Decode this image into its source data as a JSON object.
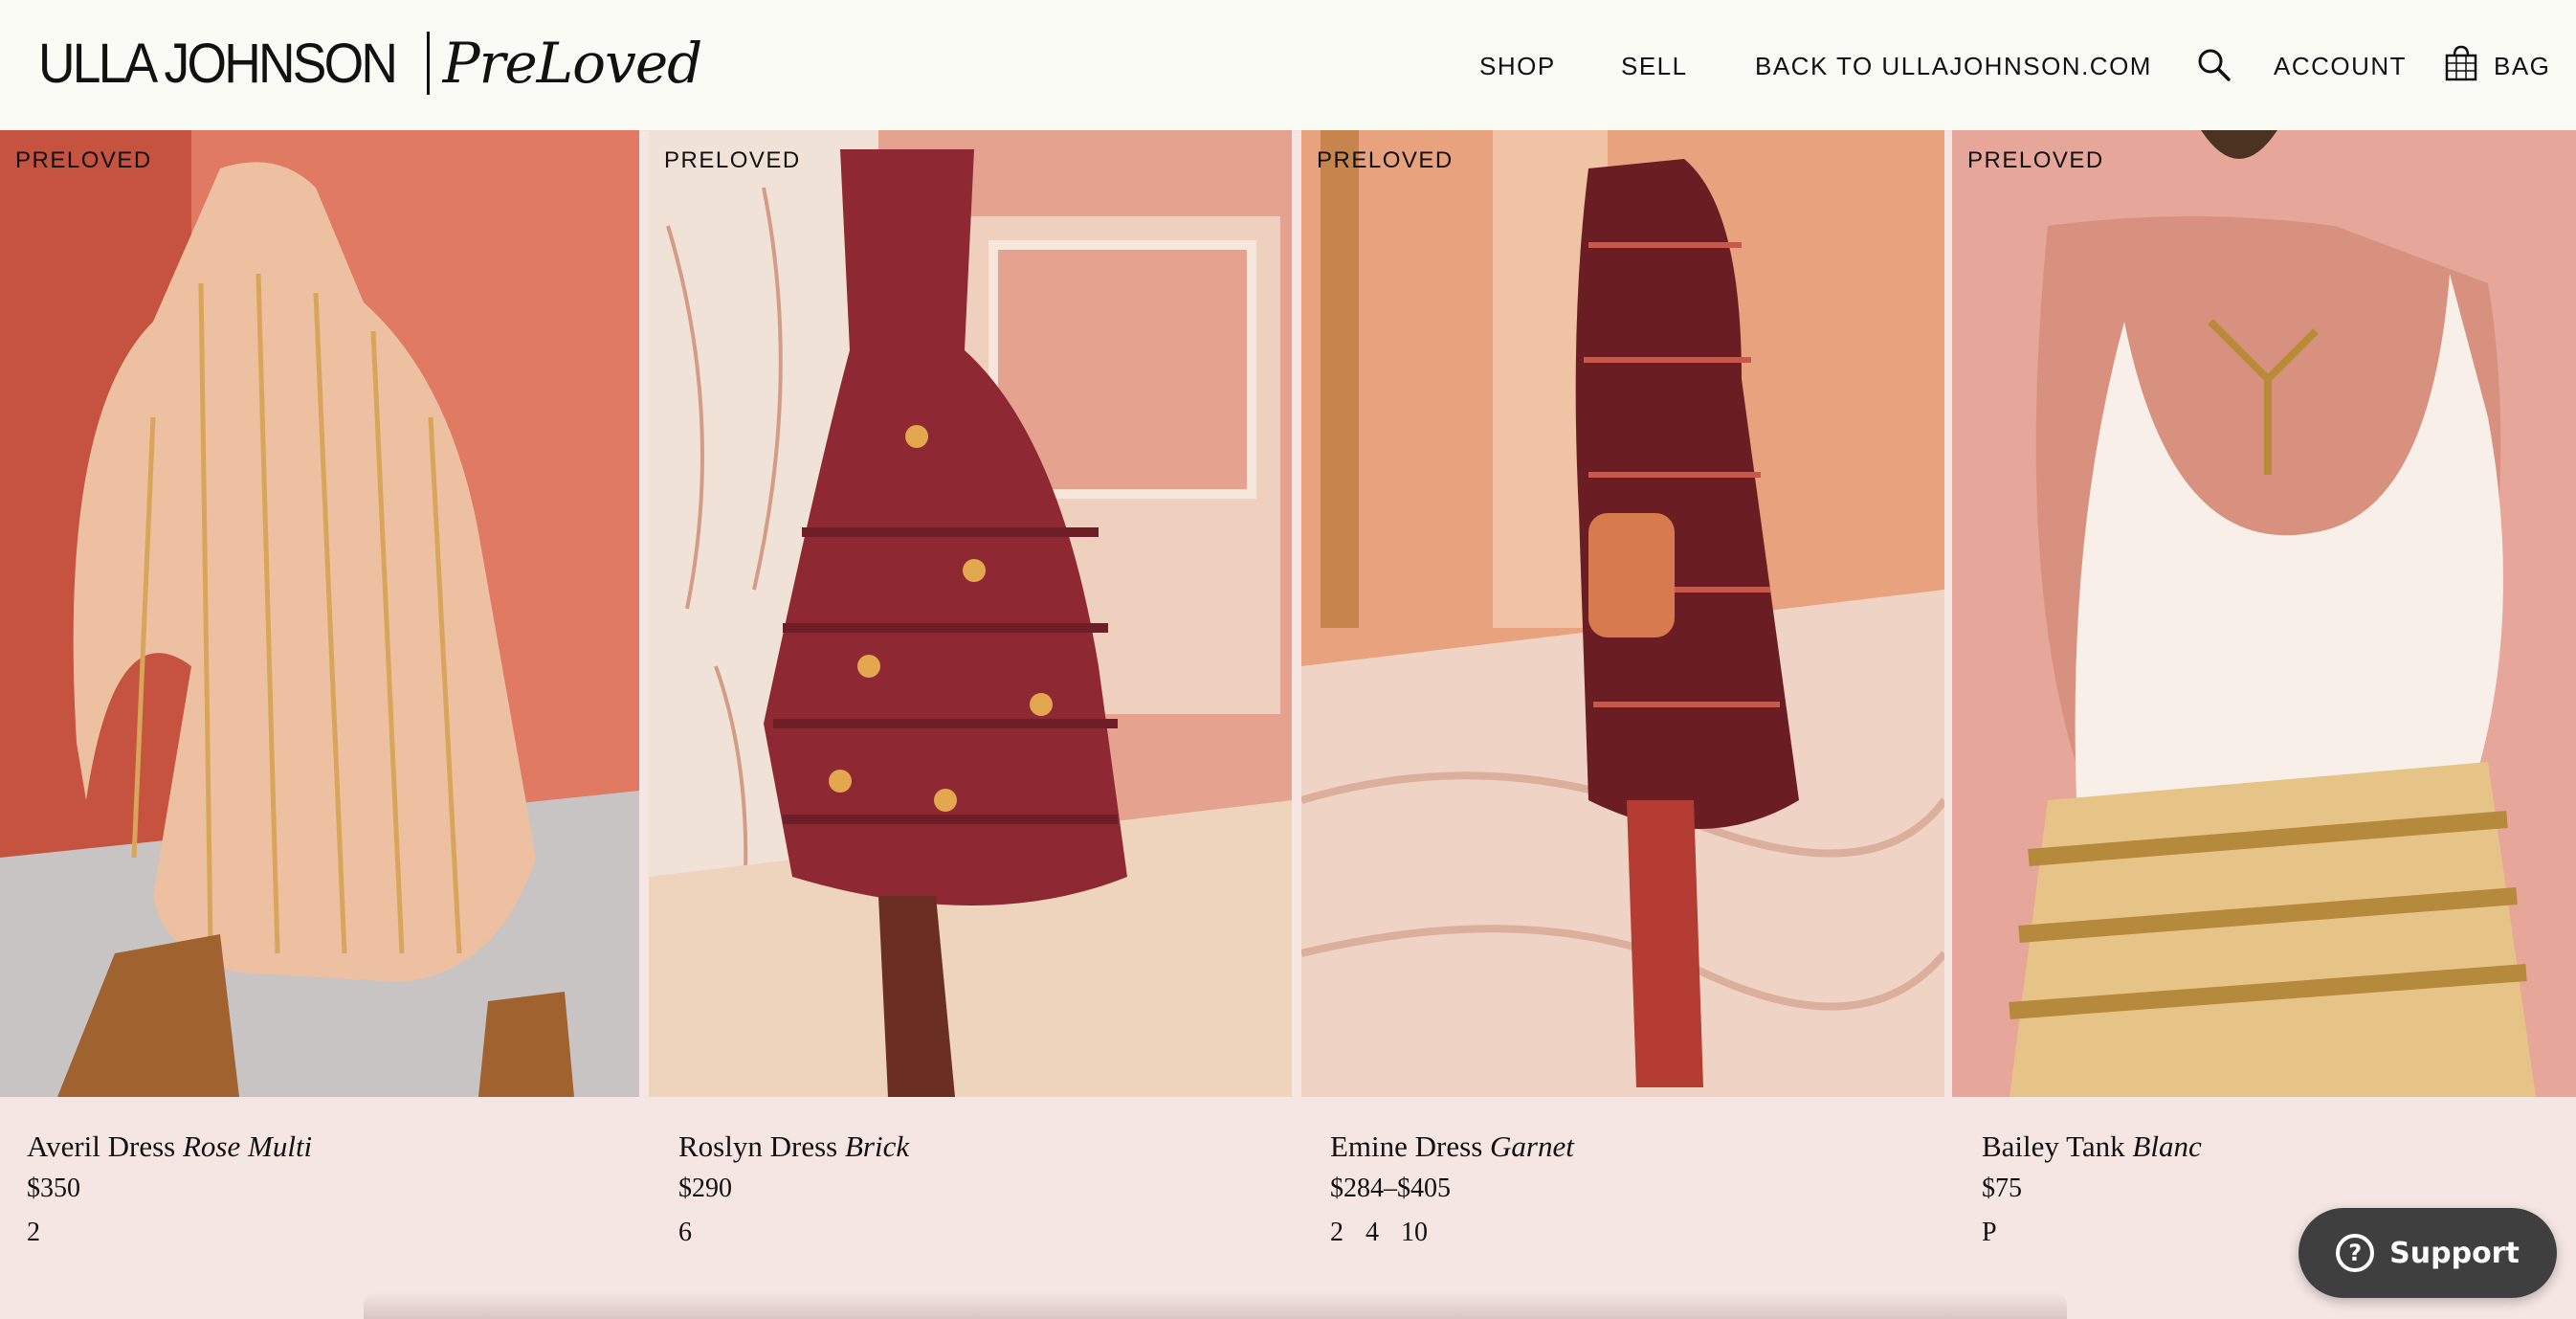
{
  "header": {
    "logo_brand": "ULLA JOHNSON",
    "logo_script": "PreLoved",
    "nav": {
      "shop": "SHOP",
      "sell": "SELL",
      "back": "BACK TO ULLAJOHNSON.COM",
      "account": "ACCOUNT",
      "bag": "BAG"
    },
    "icons": {
      "search": "search-icon",
      "bag": "bag-icon"
    }
  },
  "products": [
    {
      "tag": "PRELOVED",
      "name": "Averil Dress",
      "color": "Rose Multi",
      "price": "$350",
      "sizes": [
        "2"
      ]
    },
    {
      "tag": "PRELOVED",
      "name": "Roslyn Dress",
      "color": "Brick",
      "price": "$290",
      "sizes": [
        "6"
      ]
    },
    {
      "tag": "PRELOVED",
      "name": "Emine Dress",
      "color": "Garnet",
      "price": "$284–$405",
      "sizes": [
        "2",
        "4",
        "10"
      ]
    },
    {
      "tag": "PRELOVED",
      "name": "Bailey Tank",
      "color": "Blanc",
      "price": "$75",
      "sizes": [
        "P"
      ]
    }
  ],
  "support": {
    "label": "Support",
    "icon": "question-icon"
  },
  "colors": {
    "background": "#f5e6e3",
    "header": "#fbfbf5",
    "support_button": "#3f3f3f"
  }
}
